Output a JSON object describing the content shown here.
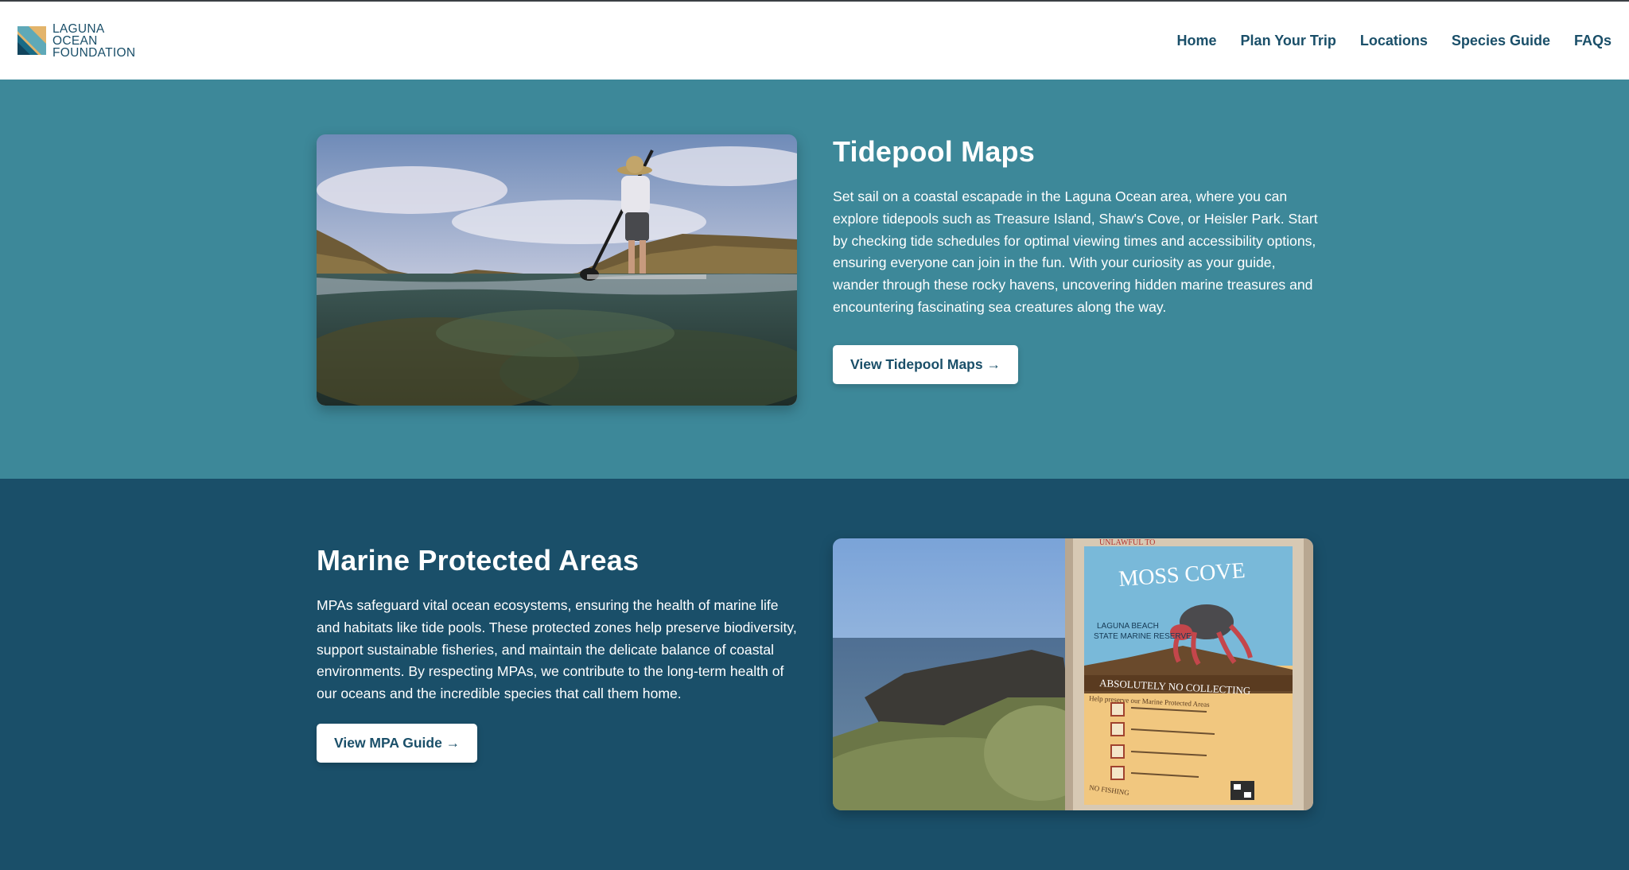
{
  "brand": {
    "logo_lines": [
      "LAGUNA",
      "OCEAN",
      "FOUNDATION"
    ],
    "colors": {
      "primary": "#1a4f69",
      "teal": "#3d8899",
      "sand": "#e3b46b"
    }
  },
  "nav": {
    "items": [
      {
        "label": "Home"
      },
      {
        "label": "Plan Your Trip"
      },
      {
        "label": "Locations"
      },
      {
        "label": "Species Guide"
      },
      {
        "label": "FAQs"
      }
    ]
  },
  "tidepool": {
    "title": "Tidepool Maps",
    "body": "Set sail on a coastal escapade in the Laguna Ocean area, where you can explore tidepools such as Treasure Island, Shaw's Cove, or Heisler Park. Start by checking tide schedules for optimal viewing times and accessibility options, ensuring everyone can join in the fun. With your curiosity as your guide, wander through these rocky havens, uncovering hidden marine treasures and encountering fascinating sea creatures along the way.",
    "button_label": "View Tidepool Maps →"
  },
  "mpa": {
    "title": "Marine Protected Areas",
    "body": "MPAs safeguard vital ocean ecosystems, ensuring the health of marine life and habitats like tide pools. These protected zones help preserve biodiversity, support sustainable fisheries, and maintain the delicate balance of coastal environments. By respecting MPAs, we contribute to the long-term health of our oceans and the incredible species that call them home.",
    "button_label": "View MPA Guide →",
    "sign": {
      "top": "UNLAWFUL TO",
      "title": "MOSS COVE",
      "line1": "LAGUNA BEACH",
      "line2": "STATE MARINE RESERVE",
      "banner": "ABSOLUTELY NO COLLECTING",
      "subhead": "Help preserve our Marine Protected Areas",
      "bottom": "NO FISHING"
    }
  }
}
